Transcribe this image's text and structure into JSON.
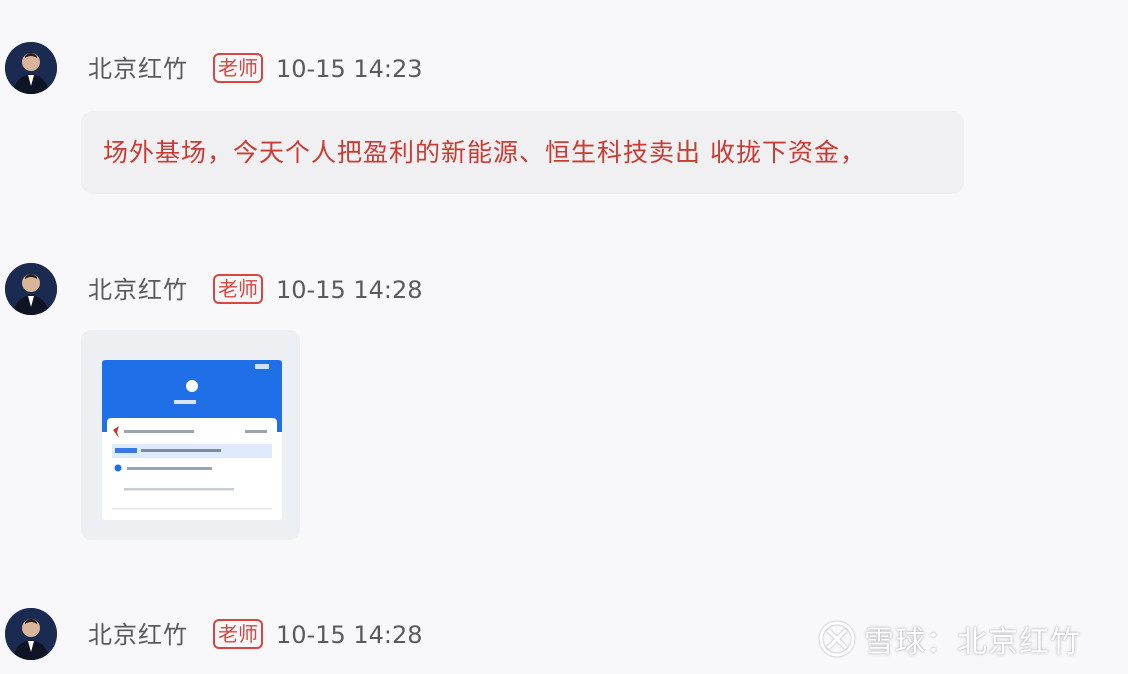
{
  "messages": [
    {
      "sender": "北京红竹",
      "badge": "老师",
      "time": "10-15 14:23",
      "text": "场外基场，今天个人把盈利的新能源、恒生科技卖出 收拢下资金，"
    },
    {
      "sender": "北京红竹",
      "badge": "老师",
      "time": "10-15 14:28",
      "attachment": "image"
    },
    {
      "sender": "北京红竹",
      "badge": "老师",
      "time": "10-15 14:28"
    }
  ],
  "watermark": {
    "text": "雪球：北京红竹",
    "icon": "xueqiu-logo-icon"
  },
  "colors": {
    "background": "#f8f8fa",
    "badge": "#d8463f",
    "message_text": "#cc3b31",
    "bubble": "#f0f0f2",
    "thumbnail_header": "#1e6fe8"
  }
}
